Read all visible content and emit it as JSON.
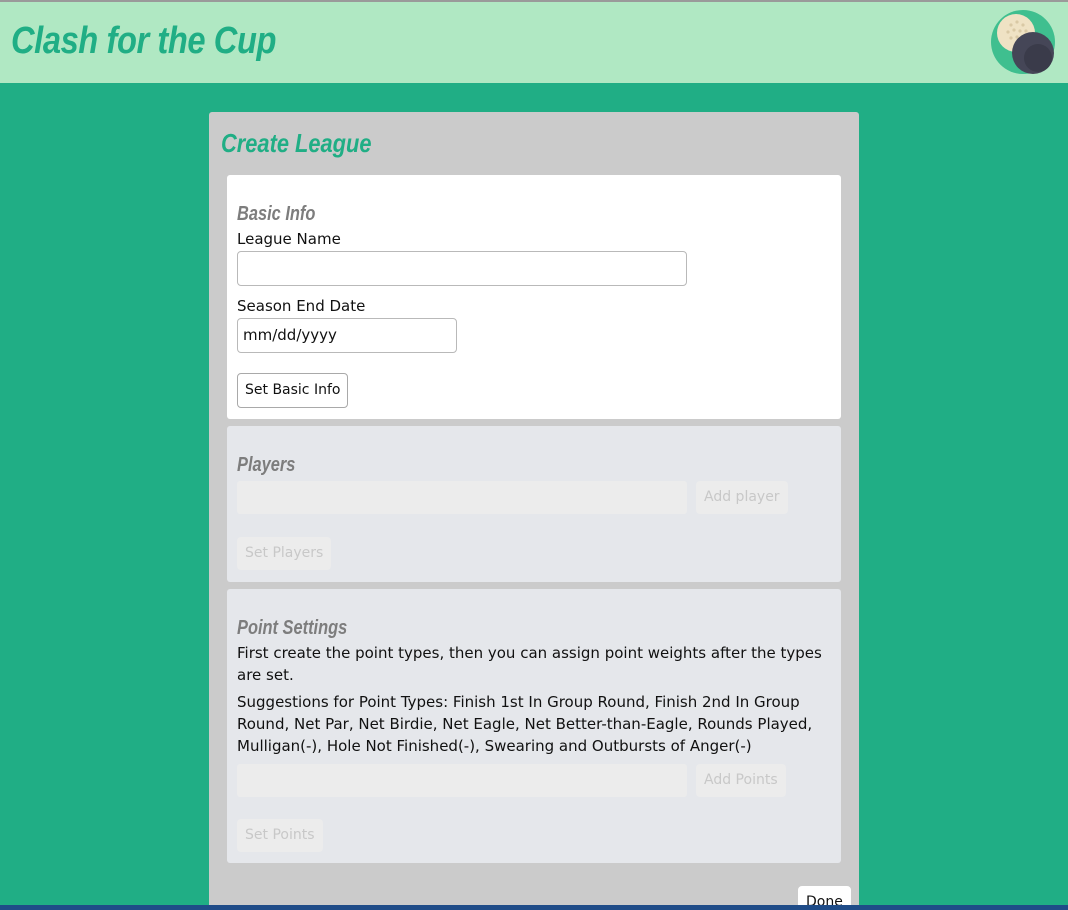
{
  "header": {
    "brand": "Clash for the Cup",
    "avatar_icon": "golf-ball-moon-icon"
  },
  "page": {
    "title": "Create League"
  },
  "basic_info": {
    "title": "Basic Info",
    "league_name_label": "League Name",
    "league_name_value": "",
    "season_end_label": "Season End Date",
    "season_end_value": "mm/dd/yyyy",
    "submit_label": "Set Basic Info"
  },
  "players": {
    "title": "Players",
    "input_value": "",
    "add_label": "Add player",
    "submit_label": "Set Players"
  },
  "point_settings": {
    "title": "Point Settings",
    "instructions": "First create the point types, then you can assign point weights after the types are set.",
    "suggestions": "Suggestions for Point Types: Finish 1st In Group Round, Finish 2nd In Group Round, Net Par, Net Birdie, Net Eagle, Net Better-than-Eagle, Rounds Played, Mulligan(-), Hole Not Finished(-), Swearing and Outbursts of Anger(-)",
    "input_value": "",
    "add_label": "Add Points",
    "submit_label": "Set Points"
  },
  "footer": {
    "done_label": "Done"
  },
  "colors": {
    "page_bg": "#20ae85",
    "header_bg": "#b0e8c3",
    "panel_bg": "#cbcbcb",
    "accent": "#20ae85"
  }
}
